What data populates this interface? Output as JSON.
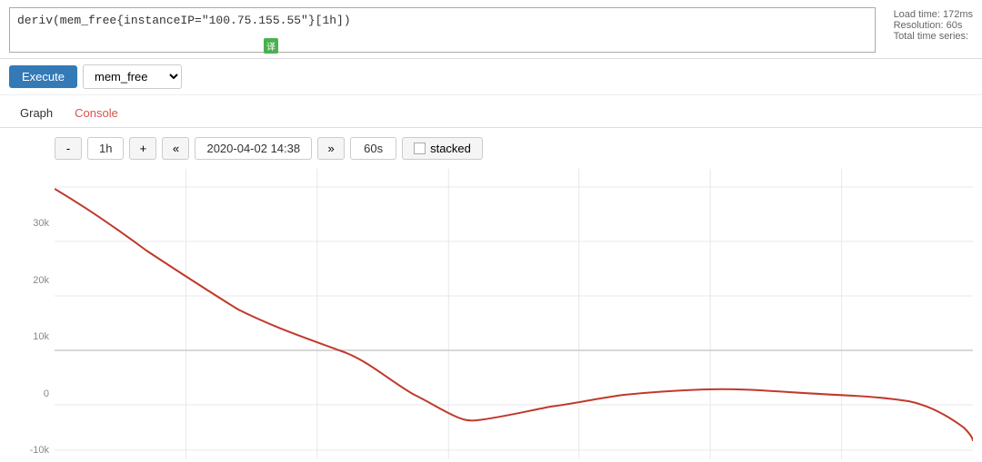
{
  "query": {
    "text": "deriv(mem_free{instanceIP=\"100.75.155.55\"}[1h])",
    "translate_badge": "译"
  },
  "top_info": {
    "load_time": "Load time: 172ms",
    "resolution": "Resolution: 60s",
    "total_time_series": "Total time series:"
  },
  "controls": {
    "execute_label": "Execute",
    "metric_value": "mem_free"
  },
  "tabs": [
    {
      "id": "graph",
      "label": "Graph",
      "active": true
    },
    {
      "id": "console",
      "label": "Console",
      "active": false
    }
  ],
  "graph_controls": {
    "minus": "-",
    "duration": "1h",
    "plus": "+",
    "rewind": "«",
    "datetime": "2020-04-02 14:38",
    "forward": "»",
    "resolution": "60s",
    "stacked_label": "stacked"
  },
  "y_axis": {
    "labels": [
      "30k",
      "20k",
      "10k",
      "0",
      "-10k"
    ]
  },
  "chart": {
    "curve_color": "#c0392b",
    "background": "#fff",
    "grid_color": "#e8e8e8"
  }
}
